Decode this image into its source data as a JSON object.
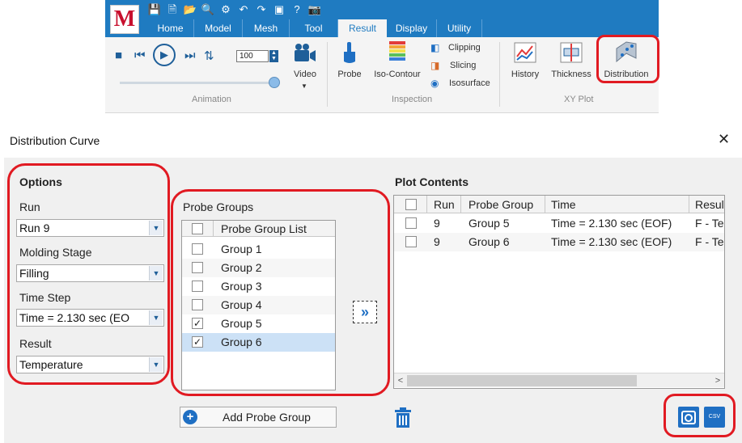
{
  "ribbon": {
    "logo": "M",
    "tabs": [
      "Home",
      "Model",
      "Mesh",
      "Tool",
      "Result",
      "Display",
      "Utility"
    ],
    "active_tab": "Result",
    "speed_value": "100",
    "groups": {
      "animation": {
        "label": "Animation",
        "video_label": "Video"
      },
      "inspection": {
        "label": "Inspection",
        "probe": "Probe",
        "iso_contour": "Iso-Contour",
        "clipping": "Clipping",
        "slicing": "Slicing",
        "isosurface": "Isosurface"
      },
      "xyplot": {
        "label": "XY Plot",
        "history": "History",
        "thickness": "Thickness",
        "distribution": "Distribution"
      }
    }
  },
  "dialog": {
    "title": "Distribution Curve",
    "close": "✕",
    "options": {
      "title": "Options",
      "run_label": "Run",
      "run_value": "Run 9",
      "stage_label": "Molding Stage",
      "stage_value": "Filling",
      "timestep_label": "Time Step",
      "timestep_value": "Time = 2.130 sec (EO",
      "result_label": "Result",
      "result_value": "Temperature"
    },
    "probe_groups": {
      "title": "Probe Groups",
      "header": "Probe Group List",
      "items": [
        {
          "name": "Group 1",
          "checked": ""
        },
        {
          "name": "Group 2",
          "checked": ""
        },
        {
          "name": "Group 3",
          "checked": ""
        },
        {
          "name": "Group 4",
          "checked": ""
        },
        {
          "name": "Group 5",
          "checked": "✓"
        },
        {
          "name": "Group 6",
          "checked": "✓"
        }
      ]
    },
    "move_button": "»",
    "plot_contents": {
      "title": "Plot Contents",
      "columns": [
        "Run",
        "Probe Group",
        "Time",
        "Resul"
      ],
      "rows": [
        {
          "run": "9",
          "group": "Group 5",
          "time": "Time = 2.130 sec (EOF)",
          "result": "F - Te"
        },
        {
          "run": "9",
          "group": "Group 6",
          "time": "Time = 2.130 sec (EOF)",
          "result": "F - Te"
        }
      ]
    },
    "add_probe_group": "Add Probe Group",
    "csv_label": "CSV"
  }
}
